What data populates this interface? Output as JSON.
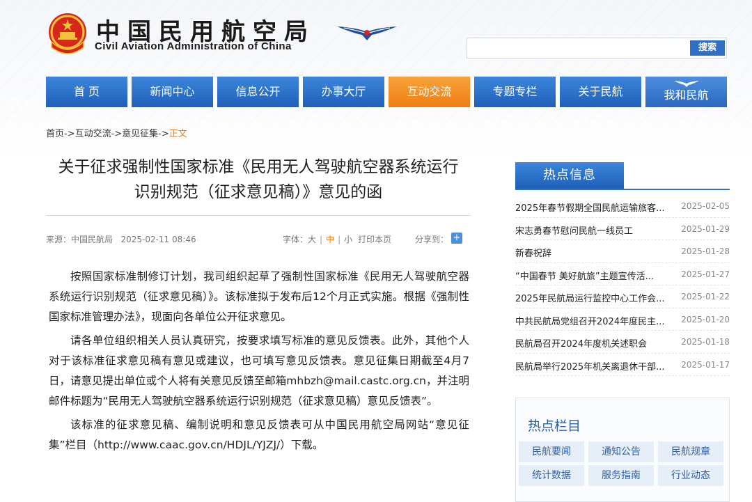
{
  "header": {
    "title_cn": "中国民用航空局",
    "title_en": "Civil Aviation Administration of China",
    "search_placeholder": "",
    "search_button": "搜索"
  },
  "nav": [
    {
      "label": "首 页"
    },
    {
      "label": "新闻中心"
    },
    {
      "label": "信息公开"
    },
    {
      "label": "办事大厅"
    },
    {
      "label": "互动交流",
      "active": true
    },
    {
      "label": "专题专栏"
    },
    {
      "label": "关于民航"
    },
    {
      "label": "我和民航"
    }
  ],
  "breadcrumb": {
    "path": "首页->互动交流->意见征集->",
    "current": "正文"
  },
  "article": {
    "title_line1": "关于征求强制性国家标准《民用无人驾驶航空器系统运行",
    "title_line2": "识别规范（征求意见稿）》意见的函",
    "meta": "来源：中国民航局   2025-02-11 08:46",
    "font_label": "字体：",
    "font_large": "大",
    "font_medium": "中",
    "font_small": "小",
    "print": "打印本页",
    "share": "分享到：",
    "paragraphs": [
      "按照国家标准制修订计划，我司组织起草了强制性国家标准《民用无人驾驶航空器系统运行识别规范（征求意见稿）》。该标准拟于发布后12个月正式实施。根据《强制性国家标准管理办法》，现面向各单位公开征求意见。",
      "请各单位组织相关人员认真研究，按要求填写标准的意见反馈表。此外，其他个人对于该标准征求意见稿有意见或建议，也可填写意见反馈表。意见征集日期截至4月7日，请意见提出单位或个人将有关意见反馈至邮箱mhbzh@mail.castc.org.cn，并注明邮件标题为“民用无人驾驶航空器系统运行识别规范（征求意见稿）意见反馈表”。",
      "该标准的征求意见稿、编制说明和意见反馈表可从中国民用航空局网站“意见征集”栏目（http://www.caac.gov.cn/HDJL/YJZJ/）下载。"
    ]
  },
  "hot_info": {
    "title": "热点信息",
    "items": [
      {
        "title": "2025年春节假期全国民航运输旅客...",
        "date": "2025-02-05"
      },
      {
        "title": "宋志勇春节慰问民航一线员工",
        "date": "2025-01-29"
      },
      {
        "title": "新春祝辞",
        "date": "2025-01-28"
      },
      {
        "title": "“中国春节 美好航旅”主题宣传活...",
        "date": "2025-01-27"
      },
      {
        "title": "2025年民航局运行监控中心工作会...",
        "date": "2025-01-22"
      },
      {
        "title": "中共民航局党组召开2024年度民主...",
        "date": "2025-01-20"
      },
      {
        "title": "民航局召开2024年度机关述职会",
        "date": "2025-01-18"
      },
      {
        "title": "民航局举行2025年机关离退休干部...",
        "date": "2025-01-17"
      }
    ]
  },
  "hot_columns": {
    "title": "热点栏目",
    "items": [
      "民航要闻",
      "通知公告",
      "民航规章",
      "统计数据",
      "服务指南",
      "行业动态"
    ]
  }
}
